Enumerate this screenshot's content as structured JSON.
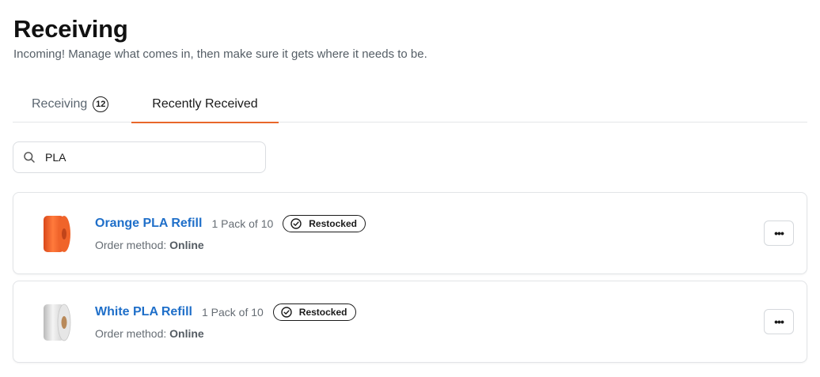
{
  "header": {
    "title": "Receiving",
    "subtitle": "Incoming! Manage what comes in, then make sure it gets where it needs to be."
  },
  "tabs": [
    {
      "label": "Receiving",
      "count": "12",
      "active": false
    },
    {
      "label": "Recently Received",
      "active": true
    }
  ],
  "search": {
    "value": "PLA",
    "icon": "search-icon"
  },
  "items": [
    {
      "title": "Orange PLA Refill",
      "pack": "1 Pack of 10",
      "status": "Restocked",
      "order_method_label": "Order method:",
      "order_method_value": "Online",
      "spool_color": "#f0642a",
      "more_label": "•••"
    },
    {
      "title": "White PLA Refill",
      "pack": "1 Pack of 10",
      "status": "Restocked",
      "order_method_label": "Order method:",
      "order_method_value": "Online",
      "spool_color": "#e6e6e6",
      "more_label": "•••"
    }
  ],
  "colors": {
    "accent": "#e8672a",
    "link": "#1f6fc9"
  }
}
